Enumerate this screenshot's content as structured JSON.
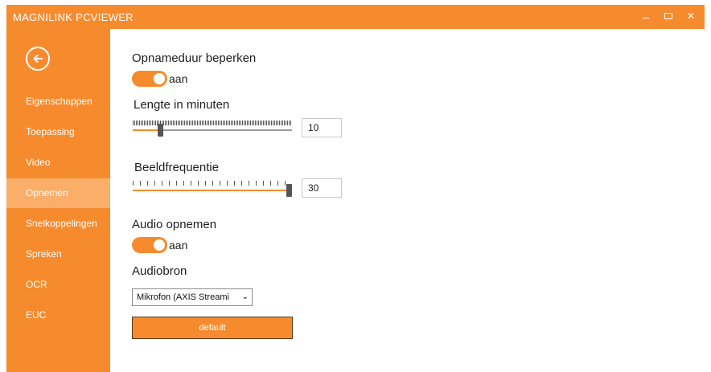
{
  "window": {
    "title": "MAGNILINK PCVIEWER",
    "accent_color": "#F68B2E",
    "controls": {
      "minimize_icon": "minimize-icon",
      "maximize_icon": "maximize-icon",
      "close_label": "✕"
    }
  },
  "sidebar": {
    "back_icon": "back-arrow-icon",
    "items": [
      {
        "label": "Eigenschappen",
        "active": false
      },
      {
        "label": "Toepassing",
        "active": false
      },
      {
        "label": "Video",
        "active": false
      },
      {
        "label": "Opnemen",
        "active": true
      },
      {
        "label": "Snelkoppelingen",
        "active": false
      },
      {
        "label": "Spreken",
        "active": false
      },
      {
        "label": "OCR",
        "active": false
      },
      {
        "label": "EUC",
        "active": false
      }
    ]
  },
  "main": {
    "limit_duration": {
      "label": "Opnameduur beperken",
      "toggle_text": "aan",
      "on": true
    },
    "length_minutes": {
      "label": "Lengte in minuten",
      "value": "10",
      "slider_fraction": 0.17
    },
    "frame_rate": {
      "label": "Beeldfrequentie",
      "value": "30",
      "slider_fraction": 1.0
    },
    "record_audio": {
      "label": "Audio opnemen",
      "toggle_text": "aan",
      "on": true
    },
    "audio_source": {
      "label": "Audiobron",
      "selected": "Mikrofon (AXIS Streami"
    },
    "default_button": {
      "label": "default"
    }
  }
}
